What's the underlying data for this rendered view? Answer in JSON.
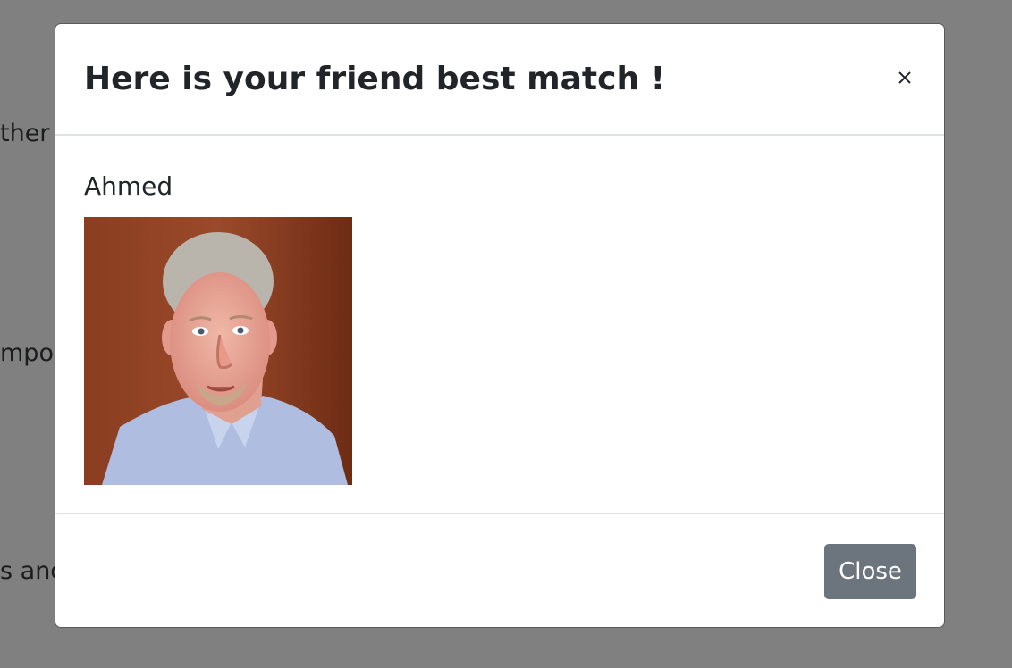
{
  "background_page": {
    "fragments": [
      "ther",
      "mpor",
      "s and"
    ]
  },
  "modal": {
    "title": "Here is your friend best match !",
    "close_icon_glyph": "×",
    "friend_name": "Ahmed",
    "photo_icon": "person-photo",
    "footer": {
      "close_label": "Close"
    }
  },
  "colors": {
    "backdrop": "#808080",
    "modal_bg": "#ffffff",
    "title_text": "#212529",
    "divider": "#dee2e6",
    "close_button_bg": "#6c757d",
    "close_button_text": "#ffffff"
  }
}
